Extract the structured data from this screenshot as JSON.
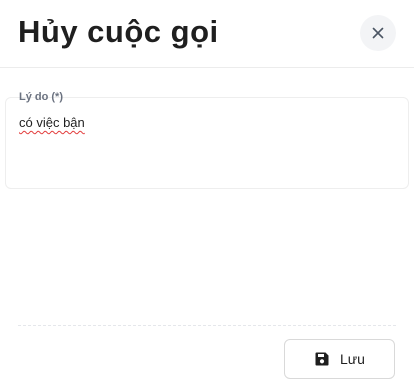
{
  "dialog": {
    "title": "Hủy cuộc gọi",
    "close_icon": "close-icon"
  },
  "form": {
    "reason_label": "Lý do (*)",
    "reason_value": "có việc bận"
  },
  "footer": {
    "save_label": "Lưu",
    "save_icon": "save-icon"
  }
}
